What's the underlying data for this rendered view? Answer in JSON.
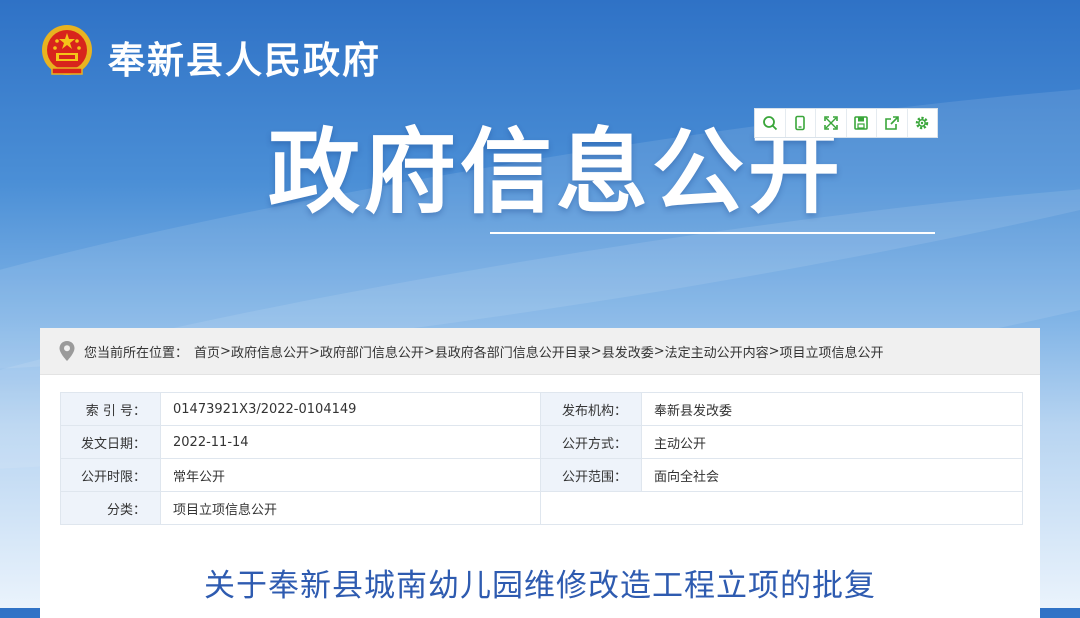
{
  "header": {
    "title": "奉新县人民政府"
  },
  "hero": {
    "title": "政府信息公开"
  },
  "toolbar": {
    "items": [
      {
        "icon": "search-icon"
      },
      {
        "icon": "mobile-icon"
      },
      {
        "icon": "fullscreen-icon"
      },
      {
        "icon": "save-icon"
      },
      {
        "icon": "share-icon"
      },
      {
        "icon": "settings-icon"
      }
    ],
    "accent_color": "#3aa63a"
  },
  "breadcrumb": {
    "label": "您当前所在位置：",
    "items": [
      "首页",
      "政府信息公开",
      "政府部门信息公开",
      "县政府各部门信息公开目录",
      "县发改委",
      "法定主动公开内容",
      "项目立项信息公开"
    ],
    "separator": ">"
  },
  "meta": {
    "rows": [
      {
        "k1": "索 引 号：",
        "v1": "01473921X3/2022-0104149",
        "k2": "发布机构：",
        "v2": "奉新县发改委"
      },
      {
        "k1": "发文日期：",
        "v1": "2022-11-14",
        "k2": "公开方式：",
        "v2": "主动公开"
      },
      {
        "k1": "公开时限：",
        "v1": "常年公开",
        "k2": "公开范围：",
        "v2": "面向全社会"
      },
      {
        "k1": "分类：",
        "v1": "项目立项信息公开",
        "k2": "",
        "v2": ""
      }
    ]
  },
  "document": {
    "title": "关于奉新县城南幼儿园维修改造工程立项的批复"
  },
  "colors": {
    "header_blue": "#2f72c6",
    "title_blue": "#2e5bb0",
    "label_bg": "#eef3fa"
  }
}
